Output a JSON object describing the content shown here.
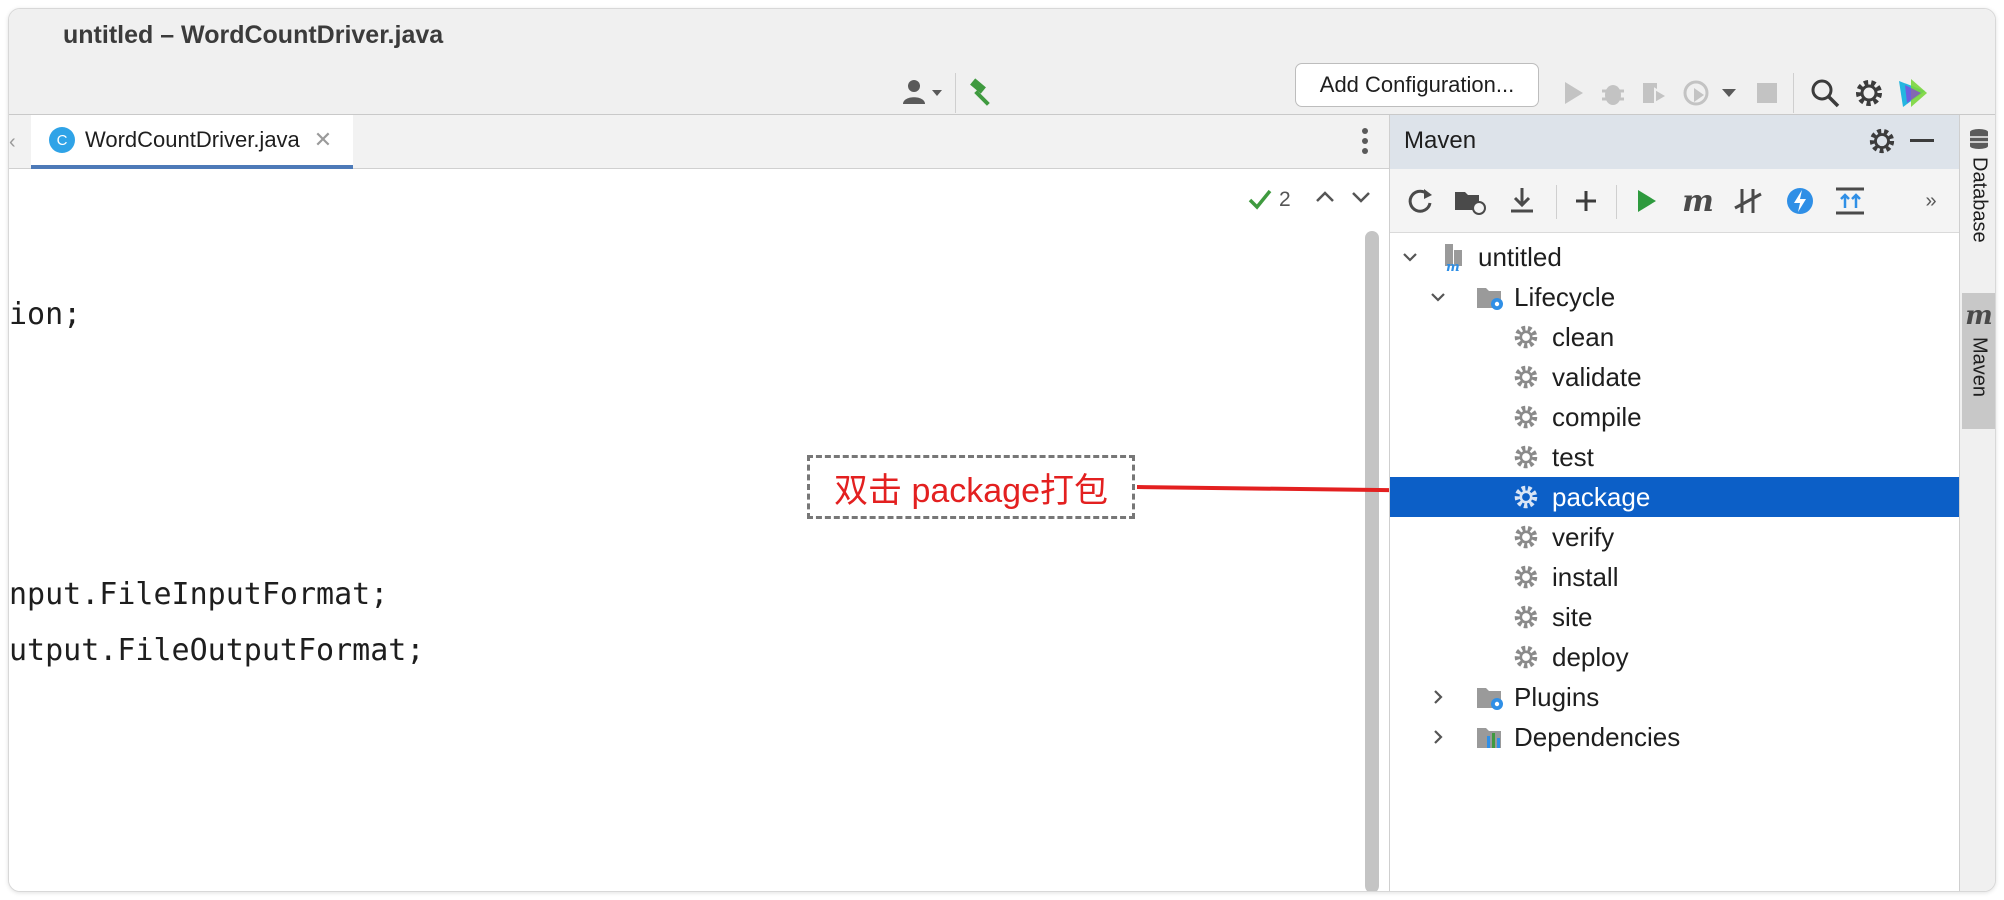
{
  "window": {
    "title": "untitled – WordCountDriver.java"
  },
  "toolbar": {
    "add_configuration_label": "Add Configuration..."
  },
  "editor": {
    "tab_label": "WordCountDriver.java",
    "problems_count": "2",
    "code_lines": [
      "ion;",
      "nput.FileInputFormat;",
      "utput.FileOutputFormat;"
    ]
  },
  "annotation": {
    "text": "双击 package打包",
    "color": "#e32020"
  },
  "maven": {
    "title": "Maven",
    "project": "untitled",
    "lifecycle_label": "Lifecycle",
    "phases": [
      "clean",
      "validate",
      "compile",
      "test",
      "package",
      "verify",
      "install",
      "site",
      "deploy"
    ],
    "selected_phase": "package",
    "plugins_label": "Plugins",
    "dependencies_label": "Dependencies",
    "selection_color": "#0c5fc7"
  },
  "side_tabs": {
    "database": "Database",
    "maven": "Maven"
  },
  "icons": {
    "toolbar": [
      "user-icon",
      "build-hammer-icon",
      "run-icon",
      "debug-icon",
      "coverage-icon",
      "profile-icon",
      "stop-icon",
      "search-icon",
      "settings-icon",
      "jetbrains-logo-icon"
    ],
    "maven_toolbar": [
      "reload-icon",
      "add-folder-icon",
      "download-icon",
      "add-icon",
      "run-icon",
      "maven-goal-icon",
      "skip-tests-icon",
      "offline-mode-icon",
      "collapse-all-icon",
      "more-icon"
    ]
  }
}
